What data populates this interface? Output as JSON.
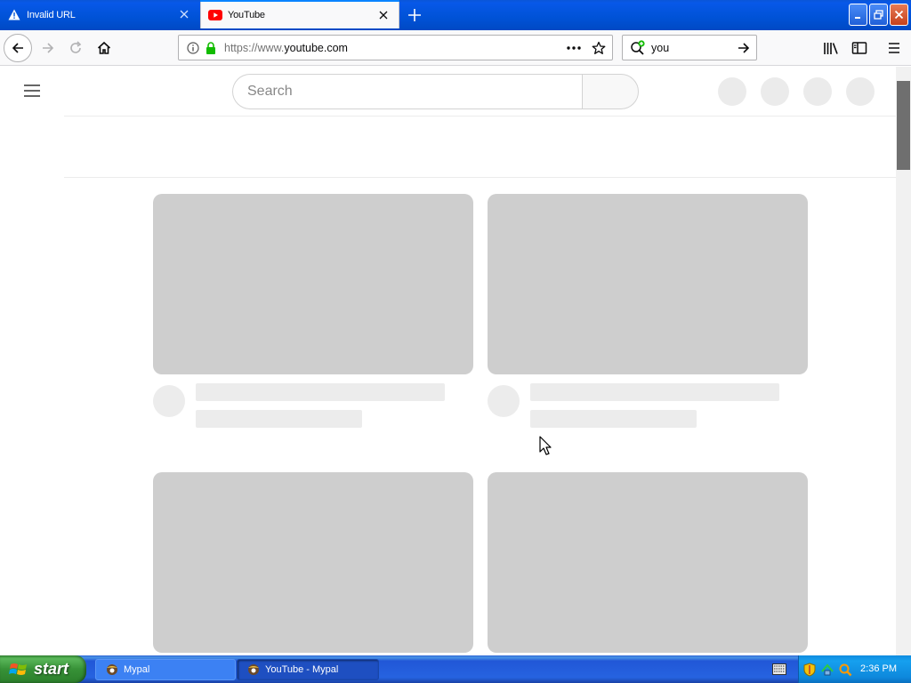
{
  "tabs": [
    {
      "label": "Invalid URL",
      "icon": "warning-icon",
      "active": false
    },
    {
      "label": "YouTube",
      "icon": "youtube-icon",
      "active": true
    }
  ],
  "navbar": {
    "url_prefix": "https://www.",
    "url_host": "youtube.com",
    "search_value": "you"
  },
  "youtube": {
    "search_placeholder": "Search"
  },
  "taskbar": {
    "start_label": "start",
    "items": [
      {
        "label": "Mypal",
        "active": false
      },
      {
        "label": "YouTube - Mypal",
        "active": true
      }
    ],
    "clock": "2:36 PM"
  },
  "colors": {
    "titlebar_blue": "#0052d6",
    "skeleton_thumb": "#cecece",
    "skeleton_line": "#ececec",
    "youtube_red": "#ff0000",
    "lock_green": "#12bc00",
    "start_green": "#379137"
  }
}
